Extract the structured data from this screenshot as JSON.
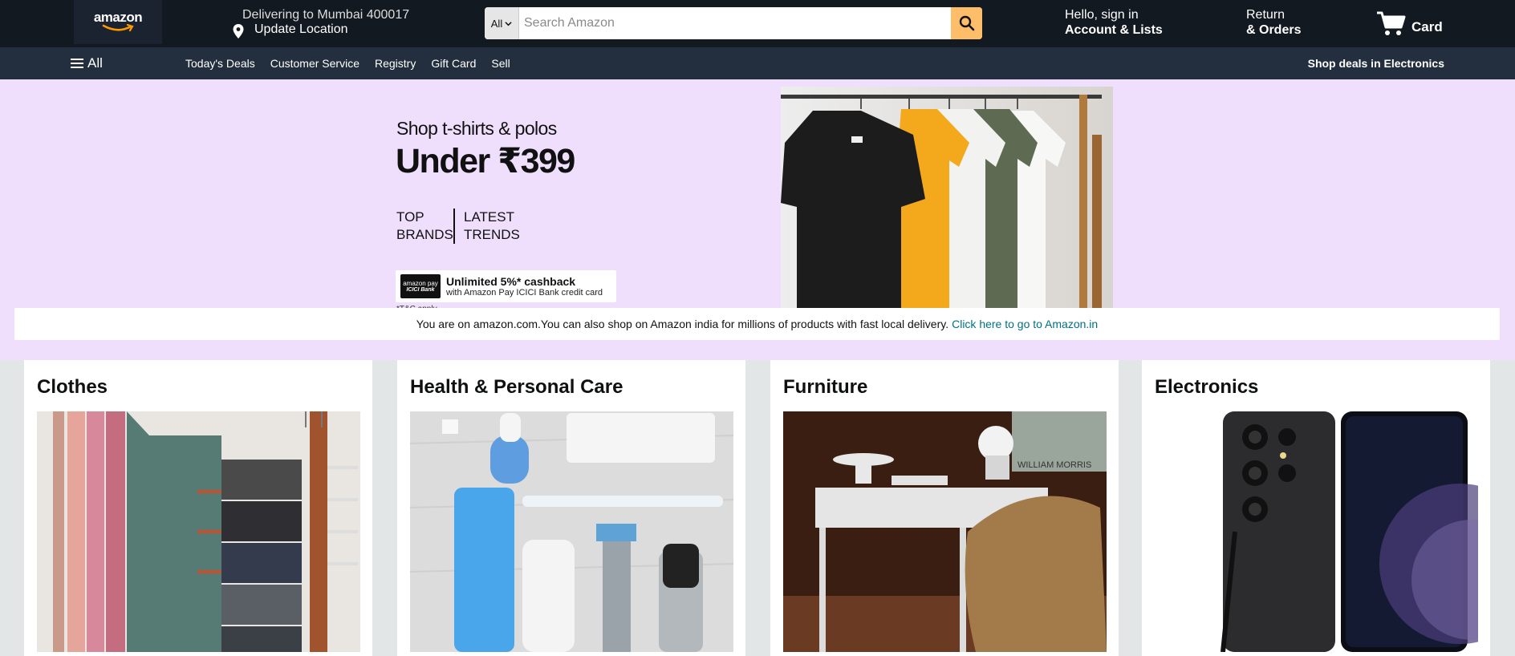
{
  "header": {
    "logo_text": "amazon",
    "deliver_line1": "Delivering to Mumbai 400017",
    "deliver_line2": "Update Location",
    "search_category": "All",
    "search_placeholder": "Search Amazon",
    "account_line1": "Hello, sign in",
    "account_line2": "Account & Lists",
    "returns_line1": "Return",
    "returns_line2": "& Orders",
    "cart_label": "Card"
  },
  "subnav": {
    "all_label": "All",
    "links": [
      "Today's Deals",
      "Customer Service",
      "Registry",
      "Gift Card",
      "Sell"
    ],
    "deals_link": "Shop deals in Electronics"
  },
  "hero": {
    "subtitle": "Shop t-shirts & polos",
    "price": "Under ₹399",
    "tag1_line1": "TOP",
    "tag1_line2": "BRANDS",
    "tag2_line1": "LATEST",
    "tag2_line2": "TRENDS",
    "cashback_logo_line1": "amazon pay",
    "cashback_logo_line2": "ICICI Bank",
    "cashback_title": "Unlimited 5%* cashback",
    "cashback_subtitle": "with Amazon Pay ICICI Bank credit card",
    "tc": "*T&C apply"
  },
  "notice": {
    "text": "You are on amazon.com.You can also shop on Amazon india for millions of products with fast local delivery.",
    "link": "Click here to go to Amazon.in"
  },
  "cards": [
    {
      "title": "Clothes"
    },
    {
      "title": "Health & Personal Care"
    },
    {
      "title": "Furniture",
      "poster_text": "WILLIAM   MORRIS"
    },
    {
      "title": "Electronics"
    }
  ],
  "colors": {
    "topbar": "#131921",
    "subnav": "#232f3e",
    "search_button": "#febd69",
    "hero_bg": "#efdffd",
    "link": "#007185"
  }
}
